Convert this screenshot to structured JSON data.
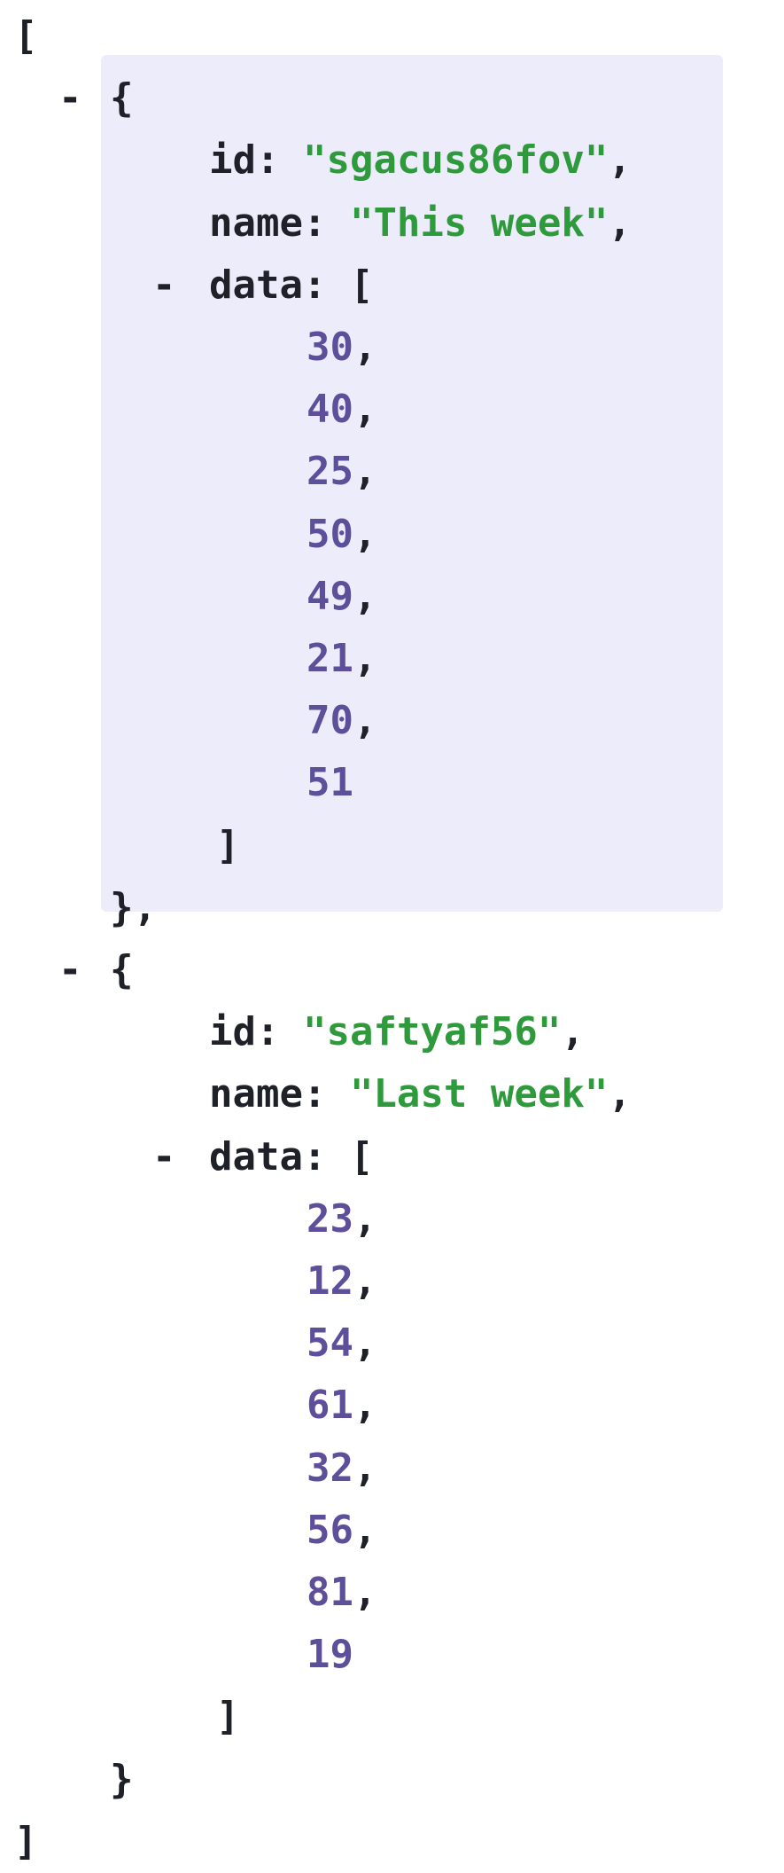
{
  "viewer": {
    "colors": {
      "key": "#1f2129",
      "string": "#2e9a3c",
      "number": "#5d4f9a",
      "highlight": "#ececfb"
    },
    "collapse_glyph": "-",
    "items": [
      {
        "id_key": "id:",
        "id_value": "\"sgacus86fov\"",
        "name_key": "name:",
        "name_value": "\"This week\"",
        "data_key": "data:",
        "data": [
          "30",
          "40",
          "25",
          "50",
          "49",
          "21",
          "70",
          "51"
        ]
      },
      {
        "id_key": "id:",
        "id_value": "\"saftyaf56\"",
        "name_key": "name:",
        "name_value": "\"Last week\"",
        "data_key": "data:",
        "data": [
          "23",
          "12",
          "54",
          "61",
          "32",
          "56",
          "81",
          "19"
        ]
      }
    ]
  }
}
